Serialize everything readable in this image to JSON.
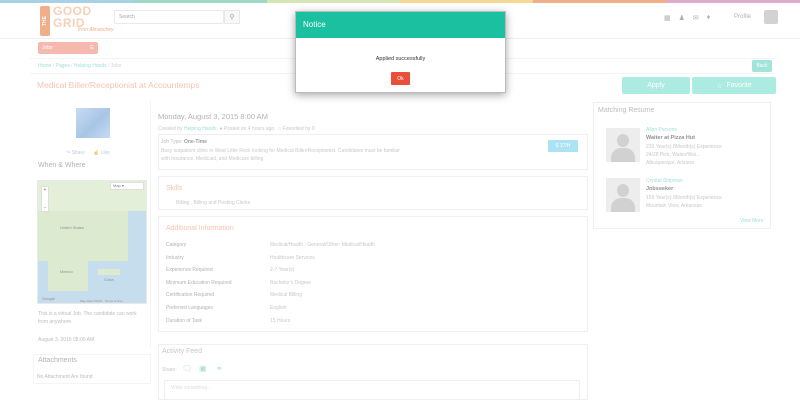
{
  "colors": {
    "accent": "#1ac0a0",
    "brand_orange": "#e8834a",
    "title_salmon": "#f3a28e",
    "ok_red": "#e8503a",
    "price_blue": "#7fd3ef",
    "strip": [
      "#7ab8d9",
      "#6cc3a8",
      "#bcd98c",
      "#f0c35b",
      "#e8834a",
      "#c97fb5"
    ]
  },
  "header": {
    "logo": {
      "the": "THE",
      "good": "GOOD",
      "grid": "GRID",
      "tagline": "from Almaschey"
    },
    "search_placeholder": "Search",
    "profile_label": "Profile",
    "icons": [
      "grid-icon",
      "people-icon",
      "mail-icon",
      "bell-icon"
    ]
  },
  "jobs_bar": {
    "label": "Jobs"
  },
  "breadcrumb": {
    "home": "Home",
    "pages": "Pages",
    "helping_hands": "Helping Hands",
    "current": "Jobs"
  },
  "back_label": "Back",
  "job": {
    "title": "Medical Biller/Receptionist at Accountemps",
    "apply_label": "Apply",
    "favorite_label": "Favorite",
    "date": "Monday, August 3, 2015 8:00 AM",
    "created_prefix": "Created by",
    "created_by": "Helping Hands",
    "posted": "Posted on 4 hours ago",
    "favorited": "Favorited by 0",
    "job_type_label": "Job Type:",
    "job_type": "One-Time",
    "description": "Busy outpatient clinic in West Little Rock looking for Medical Biller/Receptionist. Candidates must be familiar with Insurance, Medicaid, and Medicare billing",
    "price": "$ 37/H"
  },
  "left": {
    "share": "Share",
    "like": "Like",
    "when_where": "When & Where",
    "map_type": "Map",
    "map_labels": {
      "us": "United States",
      "mexico": "Mexico",
      "cuba": "Cuba",
      "google": "Google",
      "terms": "Map data ©2015 · Terms of Use"
    },
    "virtual_note": "This is a virtual Job. The candidate can work from anywhere.",
    "posted_date": "August 3, 2015 08:00 AM",
    "attachments_title": "Attachments",
    "no_attachment": "No Attachment Are found"
  },
  "skills": {
    "title": "Skills",
    "text": "Billing ,  Billing and Posting Clerks"
  },
  "additional": {
    "title": "Additional Information",
    "rows": [
      {
        "label": "Category",
        "value": "Medical/Health :  General/Other: Medical/Health"
      },
      {
        "label": "Industry",
        "value": "Healthcare Services"
      },
      {
        "label": "Experience Required",
        "value": "2-7   Year(s)"
      },
      {
        "label": "Minimum Education Required",
        "value": "Bachelor's Degree"
      },
      {
        "label": "Certification Required",
        "value": "Medical Billing"
      },
      {
        "label": "Preferred Languages",
        "value": "English"
      },
      {
        "label": "Duration of Task",
        "value": "15 Hours"
      }
    ]
  },
  "activity": {
    "title": "Activity Feed",
    "share_label": "Share:",
    "placeholder": "Write something..."
  },
  "matching": {
    "title": "Matching Resume",
    "view_more": "View More",
    "items": [
      {
        "name": "Allan Parsons",
        "role": "Waiter at Pizza Hut",
        "line1": "233 Year(s) 8Month(s) Experience",
        "line2": "24/28 Pick, Waiter/Wai...",
        "line3": "Albuquerque, Arizona"
      },
      {
        "name": "Crystal Shipman",
        "role": "Jobseeker",
        "line1": "159 Year(s) 8Month(s) Experience",
        "line2": "Mountain View, Arkansas",
        "line3": ""
      }
    ]
  },
  "modal": {
    "title": "Notice",
    "message": "Applied successfully",
    "ok_label": "Ok"
  }
}
